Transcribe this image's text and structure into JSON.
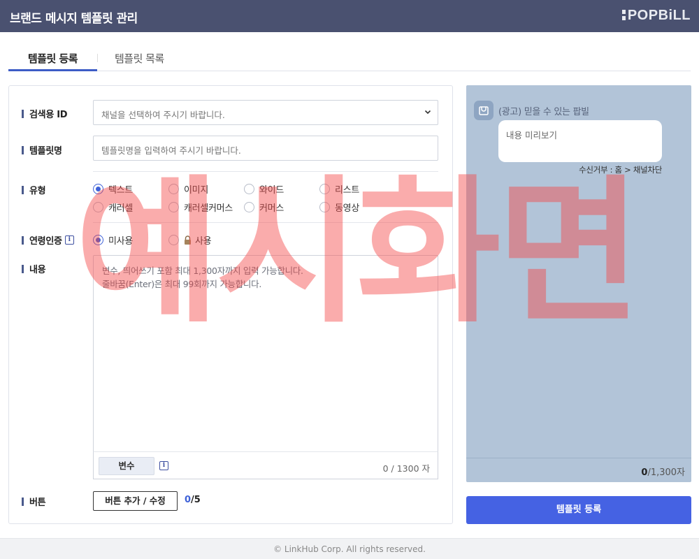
{
  "header": {
    "title": "브랜드 메시지 템플릿 관리",
    "logo": "POPBiLL"
  },
  "tabs": [
    {
      "label": "템플릿 등록",
      "active": true
    },
    {
      "label": "템플릿 목록",
      "active": false
    }
  ],
  "form": {
    "search_id": {
      "label": "검색용 ID",
      "placeholder": "채널을 선택하여 주시기 바랍니다."
    },
    "template_name": {
      "label": "템플릿명",
      "placeholder": "템플릿명을 입력하여 주시기 바랍니다."
    },
    "type": {
      "label": "유형",
      "options": [
        "텍스트",
        "이미지",
        "와이드",
        "리스트",
        "캐러셀",
        "캐러셀커머스",
        "커머스",
        "동영상"
      ],
      "selected": "텍스트"
    },
    "age_verify": {
      "label": "연령인증",
      "options": [
        "미사용",
        "사용"
      ],
      "selected": "미사용"
    },
    "content": {
      "label": "내용",
      "placeholder_line1": "변수, 띄어쓰기 포함 최대 1,300자까지 입력 가능합니다.",
      "placeholder_line2": "줄바꿈(Enter)은 최대 99회까지 가능합니다.",
      "var_button": "변수",
      "char_count": "0 / 1300 자"
    },
    "buttons": {
      "label": "버튼",
      "add_button": "버튼 추가 / 수정",
      "count_current": "0",
      "count_max": "/5"
    }
  },
  "preview": {
    "title": "(광고) 믿을 수 있는 팝빌",
    "placeholder": "내용 미리보기",
    "reject_text": "수신거부 : 홈 > 채널차단",
    "count_current": "0",
    "count_max": "/1,300자"
  },
  "submit_label": "템플릿 등록",
  "footer": "© LinkHub Corp. All rights reserved.",
  "watermark": "예시화면",
  "colors": {
    "header_bg": "#4a5170",
    "accent": "#4562e3",
    "preview_bg": "#b2c4d8"
  }
}
